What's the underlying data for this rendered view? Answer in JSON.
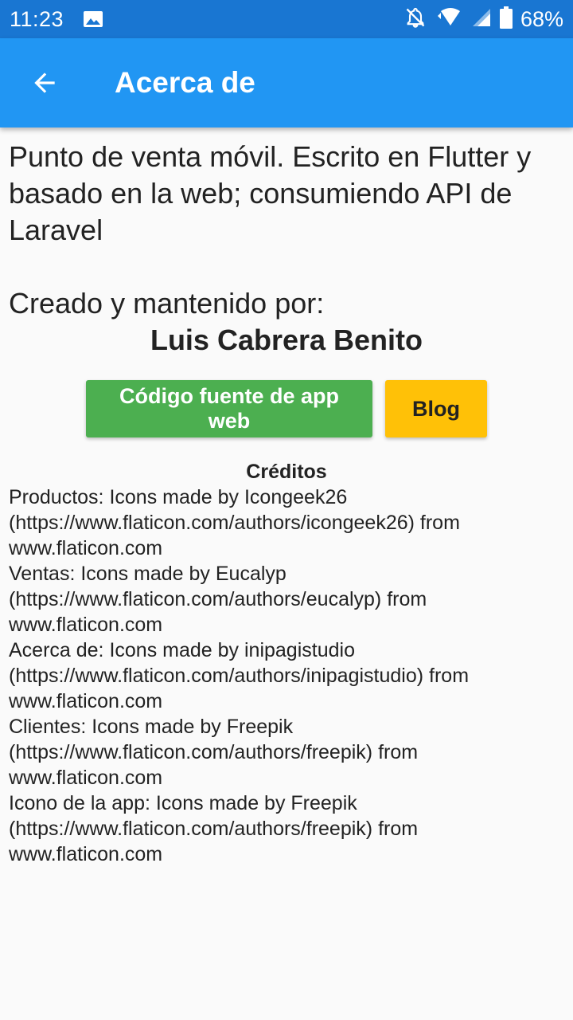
{
  "status_bar": {
    "time": "11:23",
    "battery": "68%",
    "icons": [
      "image-icon",
      "notifications-off-icon",
      "wifi-icon",
      "signal-icon",
      "battery-icon"
    ]
  },
  "app_bar": {
    "title": "Acerca de",
    "back_icon": "arrow-back-icon",
    "color": "#2196f3"
  },
  "about": {
    "intro": "Punto de venta móvil. Escrito en Flutter y basado en la web; consumiendo API de Laravel",
    "created_label": "Creado y mantenido por:",
    "author": "Luis Cabrera Benito"
  },
  "buttons": {
    "source": {
      "label": "Código fuente de app web",
      "color": "#4caf50"
    },
    "blog": {
      "label": "Blog",
      "color": "#ffc107"
    }
  },
  "credits": {
    "title": "Créditos",
    "items": [
      {
        "line1": "Productos: Icons made by Icongeek26",
        "line2": "(https://www.flaticon.com/authors/icongeek26) from",
        "line3": "www.flaticon.com"
      },
      {
        "line1": "Ventas: Icons made by Eucalyp",
        "line2": "(https://www.flaticon.com/authors/eucalyp) from",
        "line3": "www.flaticon.com"
      },
      {
        "line1": "Acerca de: Icons made by inipagistudio",
        "line2": "(https://www.flaticon.com/authors/inipagistudio) from",
        "line3": "www.flaticon.com"
      },
      {
        "line1": "Clientes: Icons made by Freepik",
        "line2": "(https://www.flaticon.com/authors/freepik) from",
        "line3": "www.flaticon.com"
      },
      {
        "line1": "Icono de la app: Icons made by Freepik",
        "line2": "(https://www.flaticon.com/authors/freepik) from",
        "line3": "www.flaticon.com"
      }
    ]
  }
}
